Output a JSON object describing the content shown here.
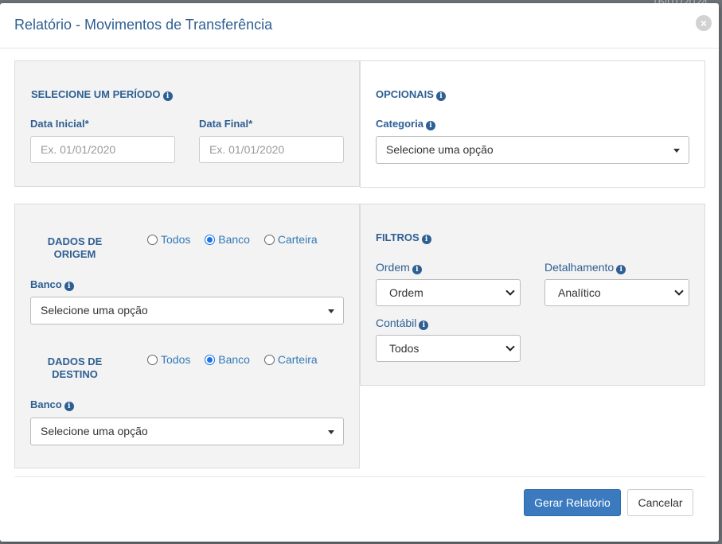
{
  "background": {
    "date_text": "16/01/2024"
  },
  "modal": {
    "title": "Relatório - Movimentos de Transferência",
    "close_label": "×"
  },
  "periodo": {
    "title": "SELECIONE UM PERÍODO",
    "data_inicial_label": "Data Inicial*",
    "data_inicial_placeholder": "Ex. 01/01/2020",
    "data_final_label": "Data Final*",
    "data_final_placeholder": "Ex. 01/01/2020"
  },
  "opcionais": {
    "title": "OPCIONAIS",
    "categoria_label": "Categoria",
    "categoria_value": "Selecione uma opção"
  },
  "origem": {
    "title_line1": "DADOS DE",
    "title_line2": "ORIGEM",
    "radio_options": [
      "Todos",
      "Banco",
      "Carteira"
    ],
    "selected": "Banco",
    "banco_label": "Banco",
    "banco_value": "Selecione uma opção"
  },
  "destino": {
    "title_line1": "DADOS DE",
    "title_line2": "DESTINO",
    "radio_options": [
      "Todos",
      "Banco",
      "Carteira"
    ],
    "selected": "Banco",
    "banco_label": "Banco",
    "banco_value": "Selecione uma opção"
  },
  "filtros": {
    "title": "FILTROS",
    "ordem_label": "Ordem",
    "ordem_value": "Ordem",
    "detalhamento_label": "Detalhamento",
    "detalhamento_value": "Analítico",
    "contabil_label": "Contábil",
    "contabil_value": "Todos"
  },
  "footer": {
    "generate_label": "Gerar Relatório",
    "cancel_label": "Cancelar"
  },
  "colors": {
    "accent": "#2e5f93",
    "primary_button": "#3b7abf",
    "panel_gray": "#f3f3f3"
  },
  "icons": [
    "info-icon",
    "close-icon",
    "caret-down-icon",
    "chevron-down-icon"
  ]
}
